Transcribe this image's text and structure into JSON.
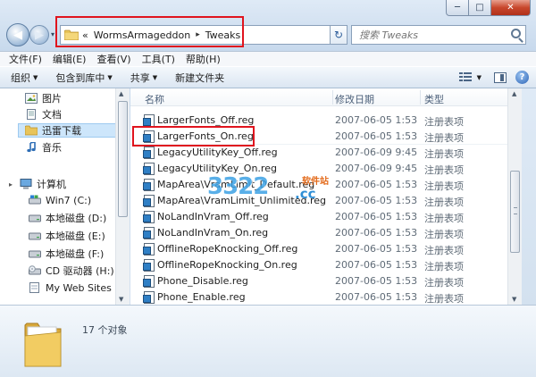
{
  "window": {
    "minimize": "─",
    "maximize": "□",
    "close": "✕"
  },
  "nav": {
    "back_glyph": "◀",
    "forward_glyph": "▶",
    "history_glyph": "▾",
    "address": {
      "overflow": "«",
      "segments": [
        "WormsArmageddon",
        "Tweaks"
      ],
      "separator": "▸",
      "dropdown": "▾"
    },
    "refresh_glyph": "↻",
    "search_placeholder": "搜索 Tweaks"
  },
  "menu": [
    "文件(F)",
    "编辑(E)",
    "查看(V)",
    "工具(T)",
    "帮助(H)"
  ],
  "toolbar": {
    "organize": "组织",
    "include_library": "包含到库中",
    "share": "共享",
    "new_folder": "新建文件夹",
    "help_glyph": "?"
  },
  "sidebar": {
    "items": [
      {
        "label": "图片",
        "icon": "pictures-library-icon"
      },
      {
        "label": "文档",
        "icon": "documents-library-icon"
      },
      {
        "label": "迅雷下载",
        "icon": "folder-icon",
        "selected": true
      },
      {
        "label": "音乐",
        "icon": "music-library-icon"
      },
      {
        "label": "计算机",
        "icon": "computer-icon",
        "root": true
      },
      {
        "label": "Win7 (C:)",
        "icon": "system-drive-icon"
      },
      {
        "label": "本地磁盘 (D:)",
        "icon": "hard-drive-icon"
      },
      {
        "label": "本地磁盘 (E:)",
        "icon": "hard-drive-icon"
      },
      {
        "label": "本地磁盘 (F:)",
        "icon": "hard-drive-icon"
      },
      {
        "label": "CD 驱动器 (H:)",
        "icon": "cd-drive-icon"
      },
      {
        "label": "My Web Sites on",
        "icon": "web-folder-icon"
      }
    ]
  },
  "file_list": {
    "columns": [
      "名称",
      "修改日期",
      "类型"
    ],
    "rows": [
      {
        "name": "LargerFonts_Off.reg",
        "date": "2007-06-05 1:53",
        "type": "注册表项"
      },
      {
        "name": "LargerFonts_On.reg",
        "date": "2007-06-05 1:53",
        "type": "注册表项"
      },
      {
        "name": "LegacyUtilityKey_Off.reg",
        "date": "2007-06-09 9:45",
        "type": "注册表项"
      },
      {
        "name": "LegacyUtilityKey_On.reg",
        "date": "2007-06-09 9:45",
        "type": "注册表项"
      },
      {
        "name": "MapArea\\VramLimit_Default.reg",
        "date": "2007-06-05 1:53",
        "type": "注册表项"
      },
      {
        "name": "MapArea\\VramLimit_Unlimited.reg",
        "date": "2007-06-05 1:53",
        "type": "注册表项"
      },
      {
        "name": "NoLandInVram_Off.reg",
        "date": "2007-06-05 1:53",
        "type": "注册表项"
      },
      {
        "name": "NoLandInVram_On.reg",
        "date": "2007-06-05 1:53",
        "type": "注册表项"
      },
      {
        "name": "OfflineRopeKnocking_Off.reg",
        "date": "2007-06-05 1:53",
        "type": "注册表项"
      },
      {
        "name": "OfflineRopeKnocking_On.reg",
        "date": "2007-06-05 1:53",
        "type": "注册表项"
      },
      {
        "name": "Phone_Disable.reg",
        "date": "2007-06-05 1:53",
        "type": "注册表项"
      },
      {
        "name": "Phone_Enable.reg",
        "date": "2007-06-05 1:53",
        "type": "注册表项"
      }
    ]
  },
  "details": {
    "count": "17 个对象"
  },
  "watermark": {
    "main": "3322",
    "sub": "软件站",
    "domain": ".cc"
  }
}
